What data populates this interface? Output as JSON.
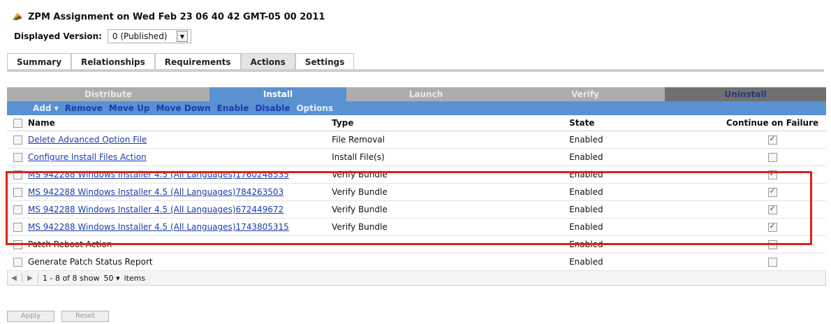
{
  "header": {
    "title": "ZPM Assignment on Wed Feb 23 06 40 42 GMT-05 00 2011",
    "icon": "bundle-icon"
  },
  "version": {
    "label": "Displayed Version:",
    "value": "0 (Published)"
  },
  "tabs": [
    {
      "label": "Summary"
    },
    {
      "label": "Relationships"
    },
    {
      "label": "Requirements"
    },
    {
      "label": "Actions",
      "active": true
    },
    {
      "label": "Settings"
    }
  ],
  "phases": [
    "Distribute",
    "Install",
    "Launch",
    "Verify",
    "Uninstall"
  ],
  "actions": {
    "add": "Add",
    "remove": "Remove",
    "move_up": "Move Up",
    "move_down": "Move Down",
    "enable": "Enable",
    "disable": "Disable",
    "options": "Options"
  },
  "table": {
    "headers": {
      "name": "Name",
      "type": "Type",
      "state": "State",
      "continue": "Continue on Failure"
    },
    "rows": [
      {
        "name": "Delete Advanced Option File",
        "type": "File Removal",
        "state": "Enabled",
        "continue": true,
        "link": true
      },
      {
        "name": "Configure Install Files Action",
        "type": "Install File(s)",
        "state": "Enabled",
        "continue": false,
        "link": true
      },
      {
        "name": "MS 942288 Windows Installer 4.5 (All Languages)1760248535",
        "type": "Verify Bundle",
        "state": "Enabled",
        "continue": true,
        "link": true
      },
      {
        "name": "MS 942288 Windows Installer 4.5 (All Languages)784263503",
        "type": "Verify Bundle",
        "state": "Enabled",
        "continue": true,
        "link": true
      },
      {
        "name": "MS 942288 Windows Installer 4.5 (All Languages)672449672",
        "type": "Verify Bundle",
        "state": "Enabled",
        "continue": true,
        "link": true
      },
      {
        "name": "MS 942288 Windows Installer 4.5 (All Languages)1743805315",
        "type": "Verify Bundle",
        "state": "Enabled",
        "continue": true,
        "link": true
      },
      {
        "name": "Patch Reboot Action",
        "type": "",
        "state": "Enabled",
        "continue": false,
        "link": false
      },
      {
        "name": "Generate Patch Status Report",
        "type": "",
        "state": "Enabled",
        "continue": false,
        "link": false
      }
    ]
  },
  "pager": {
    "range": "1 - 8 of 8 show",
    "page_size": "50",
    "items": "items"
  },
  "buttons": {
    "apply": "Apply",
    "reset": "Reset"
  },
  "colors": {
    "accent": "#5a91d2",
    "link": "#1a3da8",
    "highlight": "#e0201a"
  }
}
